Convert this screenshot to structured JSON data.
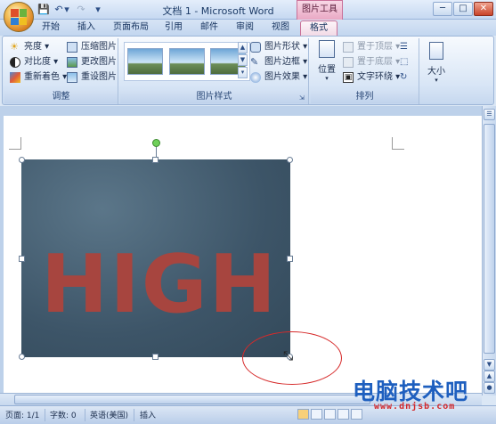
{
  "window": {
    "title": "文档 1 - Microsoft Word",
    "contextual_tab": "图片工具"
  },
  "tabs": [
    {
      "label": "开始"
    },
    {
      "label": "插入"
    },
    {
      "label": "页面布局"
    },
    {
      "label": "引用"
    },
    {
      "label": "邮件"
    },
    {
      "label": "审阅"
    },
    {
      "label": "视图"
    },
    {
      "label": "格式",
      "active": true
    }
  ],
  "ribbon": {
    "adjust": {
      "label": "调整",
      "buttons": [
        "亮度",
        "对比度",
        "重新着色",
        "压缩图片",
        "更改图片",
        "重设图片"
      ]
    },
    "picture_styles": {
      "label": "图片样式",
      "options": [
        "图片形状",
        "图片边框",
        "图片效果"
      ]
    },
    "arrange": {
      "label": "排列",
      "position": "位置",
      "bring_front": "置于顶层",
      "send_back": "置于底层",
      "text_wrap": "文字环绕"
    },
    "size": {
      "label": "大小"
    }
  },
  "document": {
    "picture_text": "HIGH"
  },
  "status": {
    "page": "页面: 1/1",
    "words": "字数: 0",
    "language": "英语(美国)",
    "mode": "插入"
  },
  "watermark": {
    "text": "电脑技术吧",
    "url": "www.dnjsb.com"
  },
  "colors": {
    "contextual_tab": "#e9a8c4",
    "picture_bg": "#3d5568",
    "picture_text": "#a7453f",
    "annotation_ellipse": "#d62a2a"
  }
}
